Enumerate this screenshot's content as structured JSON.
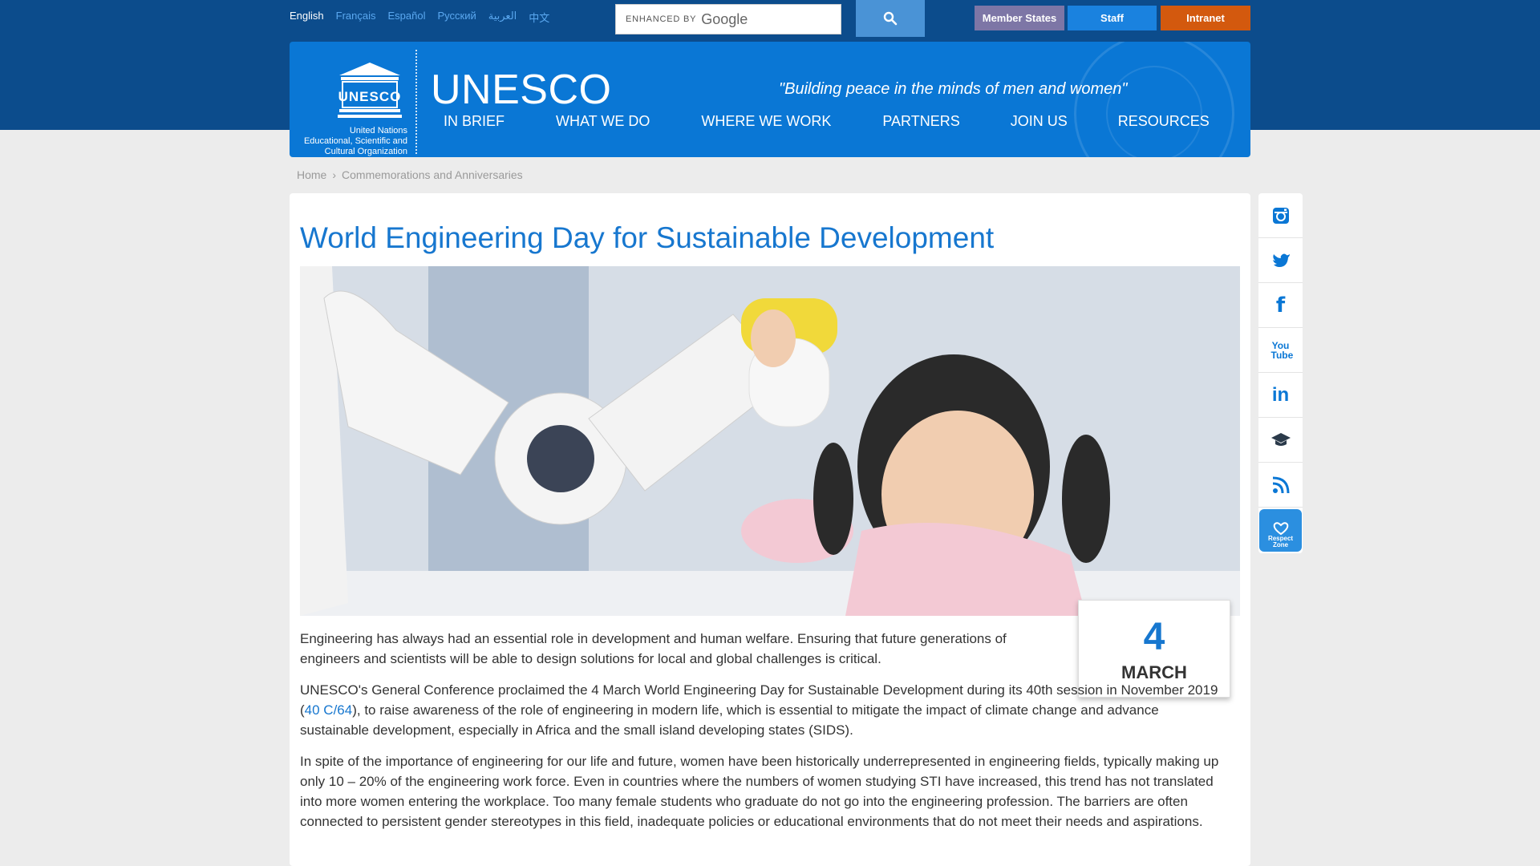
{
  "languages": [
    {
      "label": "English",
      "active": true
    },
    {
      "label": "Français",
      "active": false
    },
    {
      "label": "Español",
      "active": false
    },
    {
      "label": "Русский",
      "active": false
    },
    {
      "label": "العربية",
      "active": false
    },
    {
      "label": "中文",
      "active": false
    }
  ],
  "search": {
    "enhanced_label": "ENHANCED BY",
    "provider": "Google",
    "button_icon": "search-icon"
  },
  "top_buttons": {
    "member_states": "Member States",
    "staff": "Staff",
    "intranet": "Intranet"
  },
  "colors": {
    "top_band": "#0c4c8c",
    "banner": "#0a77d5",
    "member_states_btn": "#7d76a6",
    "staff_btn": "#1a82df",
    "intranet_btn": "#d3590e",
    "title": "#1777cf"
  },
  "banner": {
    "logo_text": "UNESCO",
    "caption_lines": [
      "United Nations",
      "Educational, Scientific and",
      "Cultural Organization"
    ],
    "brand": "UNESCO",
    "motto": "\"Building peace in the minds of men and women\""
  },
  "nav": [
    "IN BRIEF",
    "WHAT WE DO",
    "WHERE WE WORK",
    "PARTNERS",
    "JOIN US",
    "RESOURCES"
  ],
  "breadcrumb": {
    "home": "Home",
    "separator": "›",
    "current": "Commemorations and Anniversaries"
  },
  "article": {
    "title": "World Engineering Day for Sustainable Development",
    "hero_image_icon": "robot-arm-child-photo",
    "date_day": "4",
    "date_month": "MARCH",
    "p1": "Engineering has always had an essential role in development and human welfare. Ensuring that future generations of engineers and scientists will be able to design solutions for local and global challenges is critical.",
    "p2_before": "UNESCO's General Conference proclaimed the 4 March World Engineering Day for Sustainable Development during its 40th session in November 2019 (",
    "p2_link": "40 C/64",
    "p2_after": "), to raise awareness of the role of engineering in modern life, which is essential to mitigate the impact of climate change and advance sustainable development, especially in Africa and the small island developing states (SIDS).",
    "p3": "In spite of the importance of engineering for our life and future, women have been historically underrepresented in engineering fields, typically making up only 10 – 20% of the engineering work force.  Even in countries where the numbers of women studying STI have increased, this trend has not translated into more women entering the workplace. Too many female students who graduate do not go into the engineering profession. The barriers are often connected to persistent gender stereotypes in this field, inadequate policies or educational environments that do not meet their needs and aspirations."
  },
  "social": {
    "icons": [
      "instagram-icon",
      "twitter-icon",
      "facebook-icon",
      "youtube-icon",
      "linkedin-icon",
      "graduation-cap-icon",
      "rss-icon",
      "respect-zone-icon"
    ],
    "facebook_glyph": "f",
    "youtube_glyph": "You Tube",
    "linkedin_glyph": "in",
    "respect_zone_lines": [
      "Respect",
      "Zone"
    ]
  }
}
